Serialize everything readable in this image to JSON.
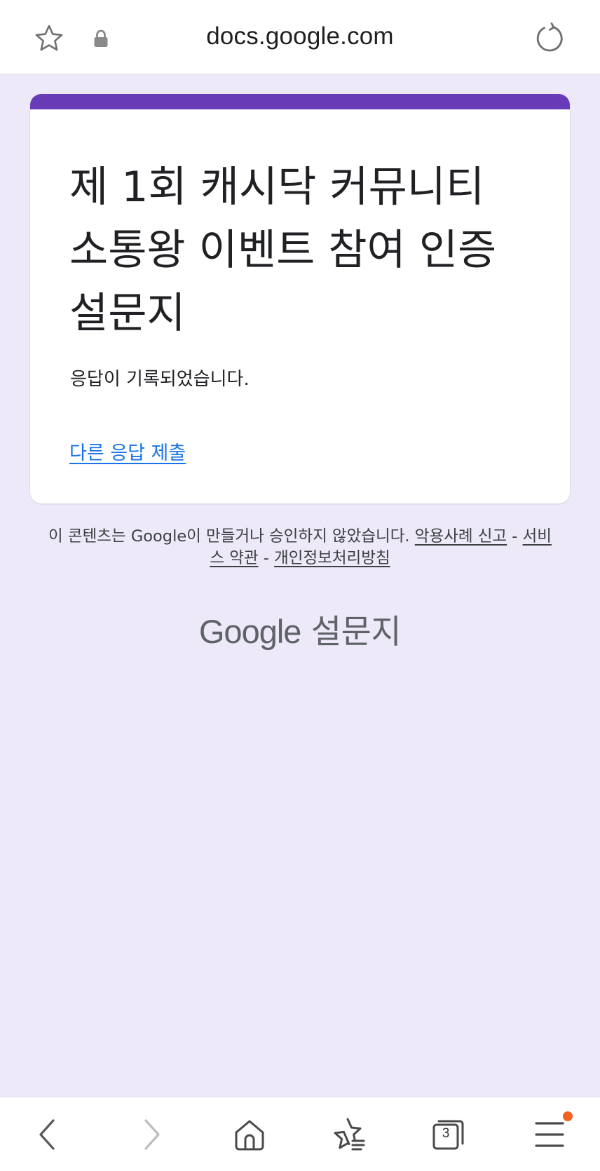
{
  "browser": {
    "url": "docs.google.com",
    "tab_count": "3",
    "icons": {
      "bookmark_star": "star-outline-icon",
      "lock": "lock-icon",
      "reload": "reload-icon"
    }
  },
  "form": {
    "title": "제 1회 캐시닥 커뮤니티 소통왕 이벤트 참여 인증 설문지",
    "confirmation": "응답이 기록되었습니다.",
    "submit_another_link": "다른 응답 제출",
    "accent_color": "#673ab7"
  },
  "footer": {
    "disclaimer": "이 콘텐츠는 Google이 만들거나 승인하지 않았습니다.",
    "report_abuse": "악용사례 신고",
    "separator": "-",
    "terms": "서비스 약관",
    "privacy": "개인정보처리방침",
    "brand_google": "Google",
    "brand_product": "설문지"
  },
  "bottom_nav": {
    "items": [
      "back-icon",
      "forward-icon",
      "home-icon",
      "bookmarks-icon",
      "tabs-icon",
      "menu-icon"
    ],
    "notification_color": "#f2611f"
  },
  "colors": {
    "page_background": "#ede9f8",
    "link": "#1a73e8",
    "text": "#202124"
  }
}
